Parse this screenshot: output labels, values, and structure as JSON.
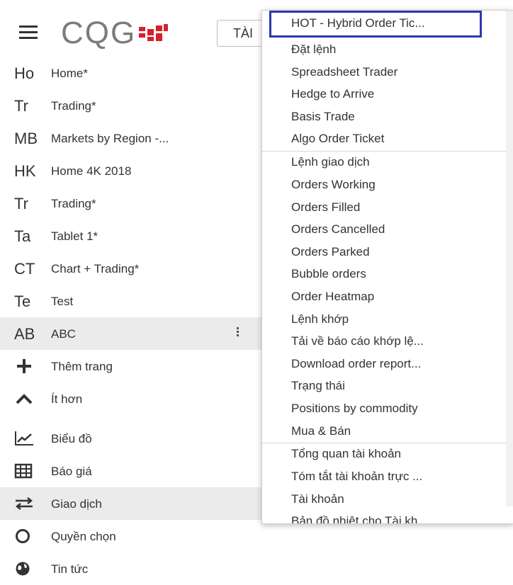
{
  "header": {
    "logo_text": "CQG",
    "top_button_label": "TÀI"
  },
  "sidebar": {
    "items": [
      {
        "abbr": "Ho",
        "label": "Home*"
      },
      {
        "abbr": "Tr",
        "label": "Trading*"
      },
      {
        "abbr": "MB",
        "label": "Markets by Region -..."
      },
      {
        "abbr": "HK",
        "label": "Home 4K 2018"
      },
      {
        "abbr": "Tr",
        "label": "Trading*"
      },
      {
        "abbr": "Ta",
        "label": "Tablet 1*"
      },
      {
        "abbr": "CT",
        "label": "Chart + Trading*"
      },
      {
        "abbr": "Te",
        "label": "Test"
      },
      {
        "abbr": "AB",
        "label": "ABC"
      }
    ],
    "add_page": {
      "icon": "plus-icon",
      "label": "Thêm trang"
    },
    "less": {
      "icon": "chevron-up-icon",
      "label": "Ít hơn"
    },
    "tools": [
      {
        "icon": "line-chart-icon",
        "label": "Biểu đồ"
      },
      {
        "icon": "grid-icon",
        "label": "Báo giá"
      },
      {
        "icon": "swap-arrows-icon",
        "label": "Giao dịch"
      },
      {
        "icon": "circle-icon",
        "label": "Quyền chọn"
      },
      {
        "icon": "globe-icon",
        "label": "Tin tức"
      }
    ]
  },
  "dropdown": {
    "highlighted": "HOT - Hybrid Order Tic...",
    "group1": [
      "Đặt lệnh",
      "Spreadsheet Trader",
      "Hedge to Arrive",
      "Basis Trade",
      "Algo Order Ticket"
    ],
    "group2": [
      "Lệnh giao dịch",
      "Orders Working",
      "Orders Filled",
      "Orders Cancelled",
      "Orders Parked",
      "Bubble orders",
      "Order Heatmap",
      "Lệnh khớp",
      "Tải về báo cáo khớp lệ...",
      "Download order report...",
      "Trạng thái",
      "Positions by commodity",
      "Mua & Bán"
    ],
    "group3": [
      "Tổng quan tài khoản",
      "Tóm tắt tài khoản trực ...",
      "Tài khoản",
      "Bản đồ nhiệt cho Tài kh..."
    ]
  },
  "colors": {
    "highlight_border": "#2b3aab",
    "logo_red": "#d6202a",
    "logo_gray": "#7b7b7b",
    "active_bg": "#ebebeb"
  }
}
